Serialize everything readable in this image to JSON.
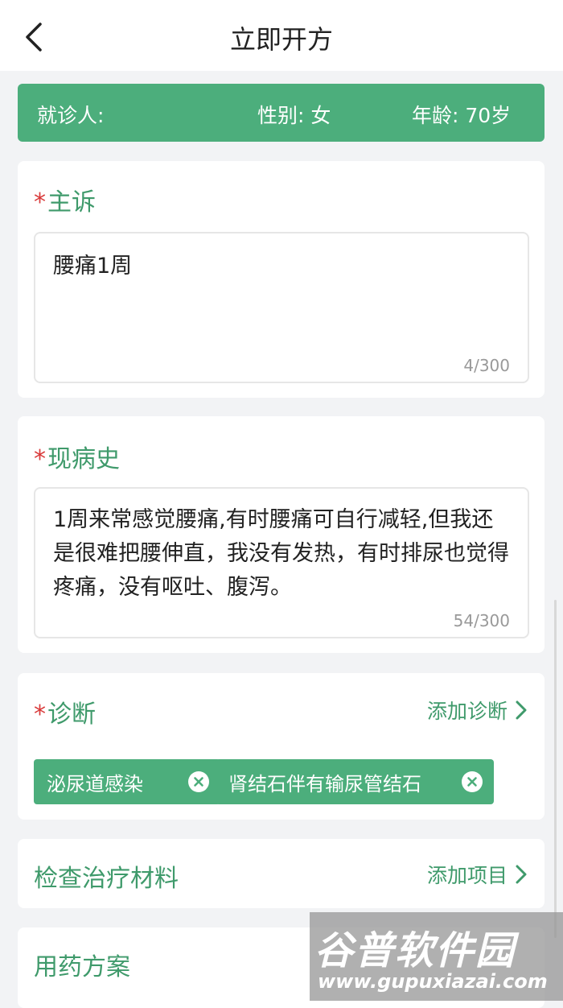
{
  "header": {
    "title": "立即开方"
  },
  "patient": {
    "name_label": "就诊人:",
    "gender_label": "性别: 女",
    "age_label": "年龄: 70岁"
  },
  "complaint": {
    "star": "*",
    "title": "主诉",
    "value": "腰痛1周",
    "counter": "4/300"
  },
  "history": {
    "star": "*",
    "title": "现病史",
    "value": "1周来常感觉腰痛,有时腰痛可自行减轻,但我还是很难把腰伸直，我没有发热，有时排尿也觉得疼痛，没有呕吐、腹泻。",
    "counter": "54/300"
  },
  "diagnosis": {
    "star": "*",
    "title": "诊断",
    "add_label": "添加诊断",
    "tags": [
      "泌尿道感染",
      "肾结石伴有输尿管结石"
    ]
  },
  "exam": {
    "title": "检查治疗材料",
    "add_label": "添加项目"
  },
  "medication": {
    "title": "用药方案"
  },
  "watermark": {
    "title": "谷普软件园",
    "url": "www.gupuxiazai.com"
  },
  "colors": {
    "accent": "#4cae7c",
    "accent_text": "#3f9a6b",
    "required_star": "#d93a3a"
  }
}
